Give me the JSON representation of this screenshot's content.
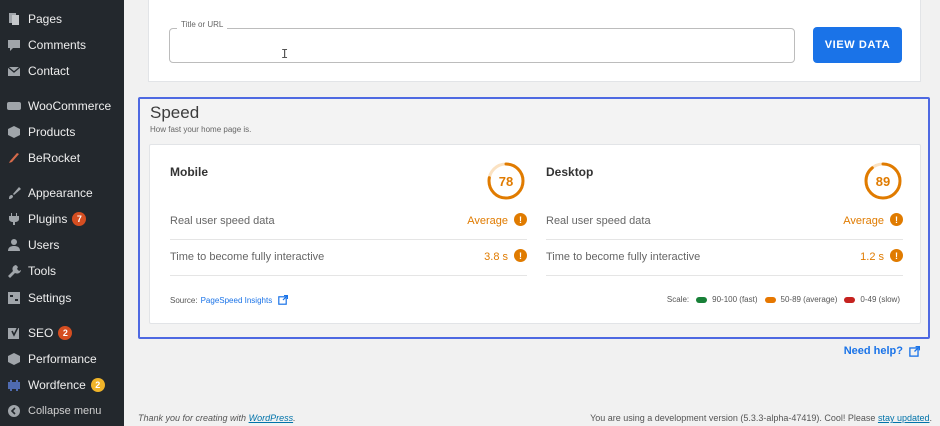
{
  "sidebar": {
    "items": [
      {
        "label": "Pages",
        "icon": "pages-icon"
      },
      {
        "label": "Comments",
        "icon": "comments-icon"
      },
      {
        "label": "Contact",
        "icon": "mail-icon"
      },
      {
        "label": "WooCommerce",
        "icon": "woocommerce-icon"
      },
      {
        "label": "Products",
        "icon": "products-icon"
      },
      {
        "label": "BeRocket",
        "icon": "berocket-icon"
      },
      {
        "label": "Appearance",
        "icon": "brush-icon"
      },
      {
        "label": "Plugins",
        "icon": "plugin-icon",
        "badge": "7"
      },
      {
        "label": "Users",
        "icon": "users-icon"
      },
      {
        "label": "Tools",
        "icon": "wrench-icon"
      },
      {
        "label": "Settings",
        "icon": "settings-icon"
      },
      {
        "label": "SEO",
        "icon": "seo-icon",
        "badge": "2"
      },
      {
        "label": "Performance",
        "icon": "performance-icon"
      },
      {
        "label": "Wordfence",
        "icon": "wordfence-icon",
        "badge": "2"
      },
      {
        "label": "Collapse menu",
        "icon": "collapse-icon"
      }
    ]
  },
  "url_panel": {
    "field_label": "Title or URL",
    "field_value": "",
    "button_label": "VIEW DATA"
  },
  "speed": {
    "title": "Speed",
    "subtitle": "How fast your home page is.",
    "mobile": {
      "title": "Mobile",
      "score": "78",
      "score_fraction": 0.78,
      "rows": [
        {
          "label": "Real user speed data",
          "value": "Average"
        },
        {
          "label": "Time to become fully interactive",
          "value": "3.8 s"
        }
      ]
    },
    "desktop": {
      "title": "Desktop",
      "score": "89",
      "score_fraction": 0.89,
      "rows": [
        {
          "label": "Real user speed data",
          "value": "Average"
        },
        {
          "label": "Time to become fully interactive",
          "value": "1.2 s"
        }
      ]
    },
    "source_prefix": "Source:",
    "source_link": "PageSpeed Insights",
    "scale_label": "Scale:",
    "scale": [
      {
        "label": "90-100 (fast)",
        "color": "#188038"
      },
      {
        "label": "50-89 (average)",
        "color": "#e67700"
      },
      {
        "label": "0-49 (slow)",
        "color": "#c5221f"
      }
    ]
  },
  "need_help": "Need help?",
  "footer": {
    "left_prefix": "Thank you for creating with",
    "left_link": "WordPress",
    "left_suffix": ".",
    "right_prefix": "You are using a development version (5.3.3-alpha-47419). Cool! Please",
    "right_link": "stay updated",
    "right_suffix": "."
  },
  "colors": {
    "accent": "#1a73e8",
    "warning": "#e07b00",
    "highlight_border": "#4e69e2",
    "sidebar_bg": "#23282d"
  }
}
